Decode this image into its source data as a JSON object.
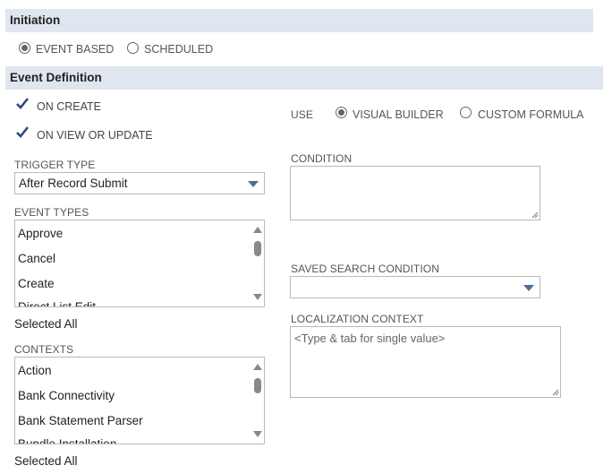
{
  "initiation": {
    "header": "Initiation",
    "options": [
      {
        "label": "EVENT BASED",
        "selected": true
      },
      {
        "label": "SCHEDULED",
        "selected": false
      }
    ]
  },
  "event_definition": {
    "header": "Event Definition",
    "on_create": {
      "label": "ON CREATE",
      "checked": true
    },
    "on_view_update": {
      "label": "ON VIEW OR UPDATE",
      "checked": true
    },
    "trigger_type": {
      "label": "TRIGGER TYPE",
      "value": "After Record Submit"
    },
    "event_types": {
      "label": "EVENT TYPES",
      "items": [
        "Approve",
        "Cancel",
        "Create",
        "Direct List Edit"
      ],
      "selected_all": "Selected All"
    },
    "contexts": {
      "label": "CONTEXTS",
      "items": [
        "Action",
        "Bank Connectivity",
        "Bank Statement Parser",
        "Bundle Installation"
      ],
      "selected_all": "Selected All"
    },
    "use": {
      "label": "USE",
      "options": [
        {
          "label": "VISUAL BUILDER",
          "selected": true
        },
        {
          "label": "CUSTOM FORMULA",
          "selected": false
        }
      ]
    },
    "condition": {
      "label": "CONDITION",
      "value": ""
    },
    "saved_search_condition": {
      "label": "SAVED SEARCH CONDITION",
      "value": ""
    },
    "localization_context": {
      "label": "LOCALIZATION CONTEXT",
      "placeholder": "<Type & tab for single value>"
    }
  },
  "colors": {
    "header_bg": "#e0e6ef",
    "check": "#2a4c7d",
    "caret": "#4d6e96"
  }
}
